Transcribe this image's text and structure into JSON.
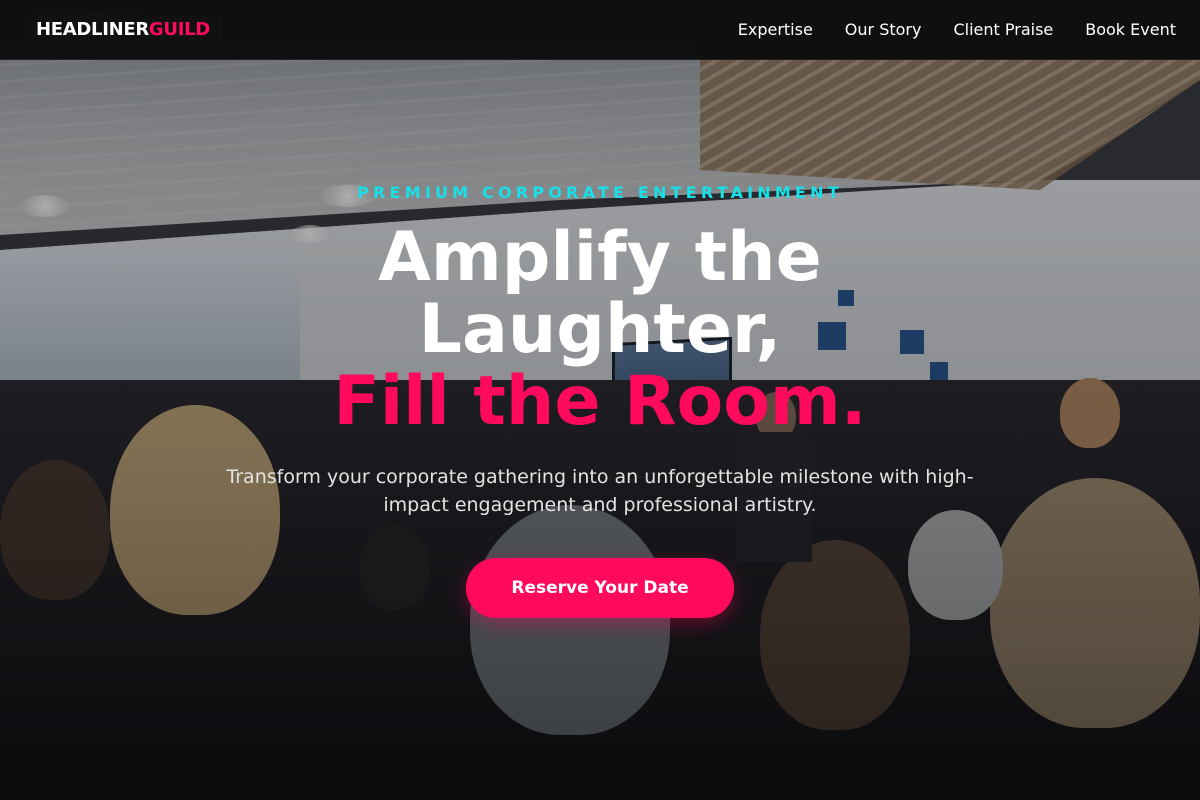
{
  "brand": {
    "name_part1": "HEADLINER",
    "name_part2": "GUILD",
    "accent_color": "#ff0a5c",
    "eyebrow_color": "#18e0e8"
  },
  "nav": {
    "items": [
      {
        "label": "Expertise"
      },
      {
        "label": "Our Story"
      },
      {
        "label": "Client Praise"
      },
      {
        "label": "Book Event"
      }
    ]
  },
  "hero": {
    "eyebrow": "PREMIUM CORPORATE ENTERTAINMENT",
    "headline_line1": "Amplify the",
    "headline_line2": "Laughter,",
    "headline_accent": "Fill the Room.",
    "subtitle": "Transform your corporate gathering into an unforgettable milestone with high-impact engagement and professional artistry.",
    "cta_label": "Reserve Your Date",
    "background_image": "photo of a speaker presenting to a crowded conference room"
  }
}
